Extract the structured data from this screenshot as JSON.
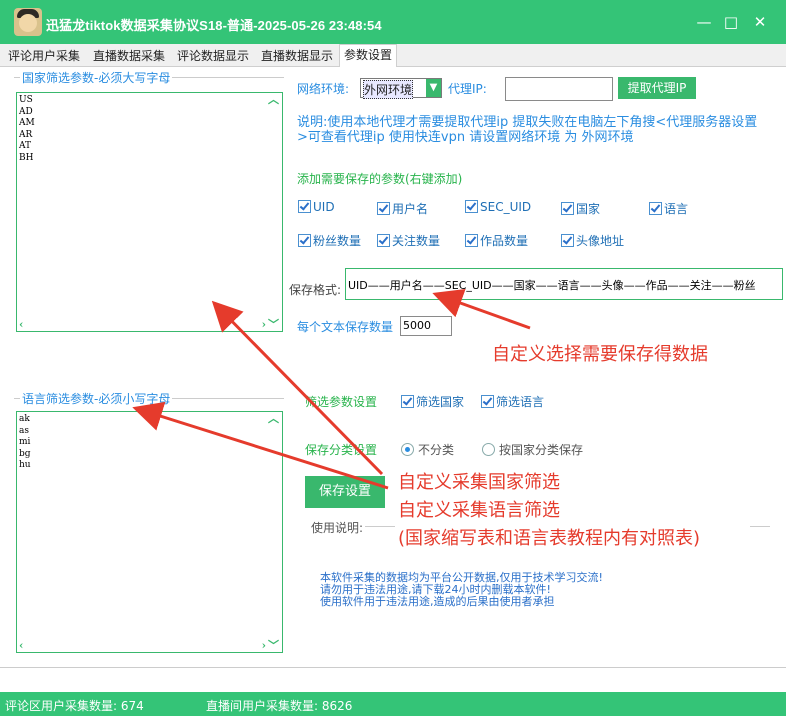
{
  "window": {
    "title": "迅猛龙tiktok数据采集协议S18-普通-2025-05-26 23:48:54",
    "minimize_glyph": "—",
    "maximize_glyph": "□",
    "close_glyph": "✕"
  },
  "tabs": [
    {
      "label": "评论用户采集"
    },
    {
      "label": "直播数据采集"
    },
    {
      "label": "评论数据显示"
    },
    {
      "label": "直播数据显示"
    },
    {
      "label": "参数设置"
    }
  ],
  "country_filter": {
    "label": "国家筛选参数-必须大写字母",
    "items": [
      "US",
      "AD",
      "AM",
      "AR",
      "AT",
      "BH"
    ]
  },
  "language_filter": {
    "label": "语言筛选参数-必须小写字母",
    "items": [
      "ak",
      "as",
      "mi",
      "bg",
      "hu"
    ]
  },
  "network": {
    "env_label": "网络环境:",
    "env_value": "外网环境",
    "proxy_label": "代理IP:",
    "proxy_value": "",
    "fetch_button": "提取代理IP",
    "note": "说明:使用本地代理才需要提取代理ip 提取失败在电脑左下角搜<代理服务器设置>可查看代理ip  使用快连vpn 请设置网络环境 为 外网环境"
  },
  "save_params": {
    "heading": "添加需要保存的参数(右键添加)",
    "checkboxes": [
      {
        "label": "UID",
        "checked": true
      },
      {
        "label": "用户名",
        "checked": true
      },
      {
        "label": "SEC_UID",
        "checked": true
      },
      {
        "label": "国家",
        "checked": true
      },
      {
        "label": "语言",
        "checked": true
      },
      {
        "label": "粉丝数量",
        "checked": true
      },
      {
        "label": "关注数量",
        "checked": true
      },
      {
        "label": "作品数量",
        "checked": true
      },
      {
        "label": "头像地址",
        "checked": true
      }
    ],
    "format_label": "保存格式:",
    "format_value": "UID——用户名——SEC_UID——国家——语言——头像——作品——关注——粉丝",
    "per_file_label": "每个文本保存数量",
    "per_file_value": "5000"
  },
  "filter_settings": {
    "label": "筛选参数设置",
    "country": "筛选国家",
    "language": "筛选语言"
  },
  "category_settings": {
    "label": "保存分类设置",
    "option_none": "不分类",
    "option_country": "按国家分类保存",
    "selected": "不分类"
  },
  "save_button": "保存设置",
  "usage": {
    "label": "使用说明:",
    "lines": [
      "本软件采集的数据均为平台公开数据,仅用于技术学习交流!",
      "请勿用于违法用途,请下载24小时内删载本软件!",
      "使用软件用于违法用途,造成的后果由使用者承担"
    ]
  },
  "annotations": {
    "custom_save": "自定义选择需要保存得数据",
    "custom_country": "自定义采集国家筛选",
    "custom_language": "自定义采集语言筛选",
    "reference_table": "(国家缩写表和语言表教程内有对照表)",
    "color": "#e53b2c"
  },
  "status": {
    "comment_users": "评论区用户采集数量: 674",
    "live_users": "直播间用户采集数量: 8626"
  },
  "colors": {
    "accent": "#34c477",
    "label_blue": "#2a8de0",
    "text_green": "#27b34b"
  }
}
